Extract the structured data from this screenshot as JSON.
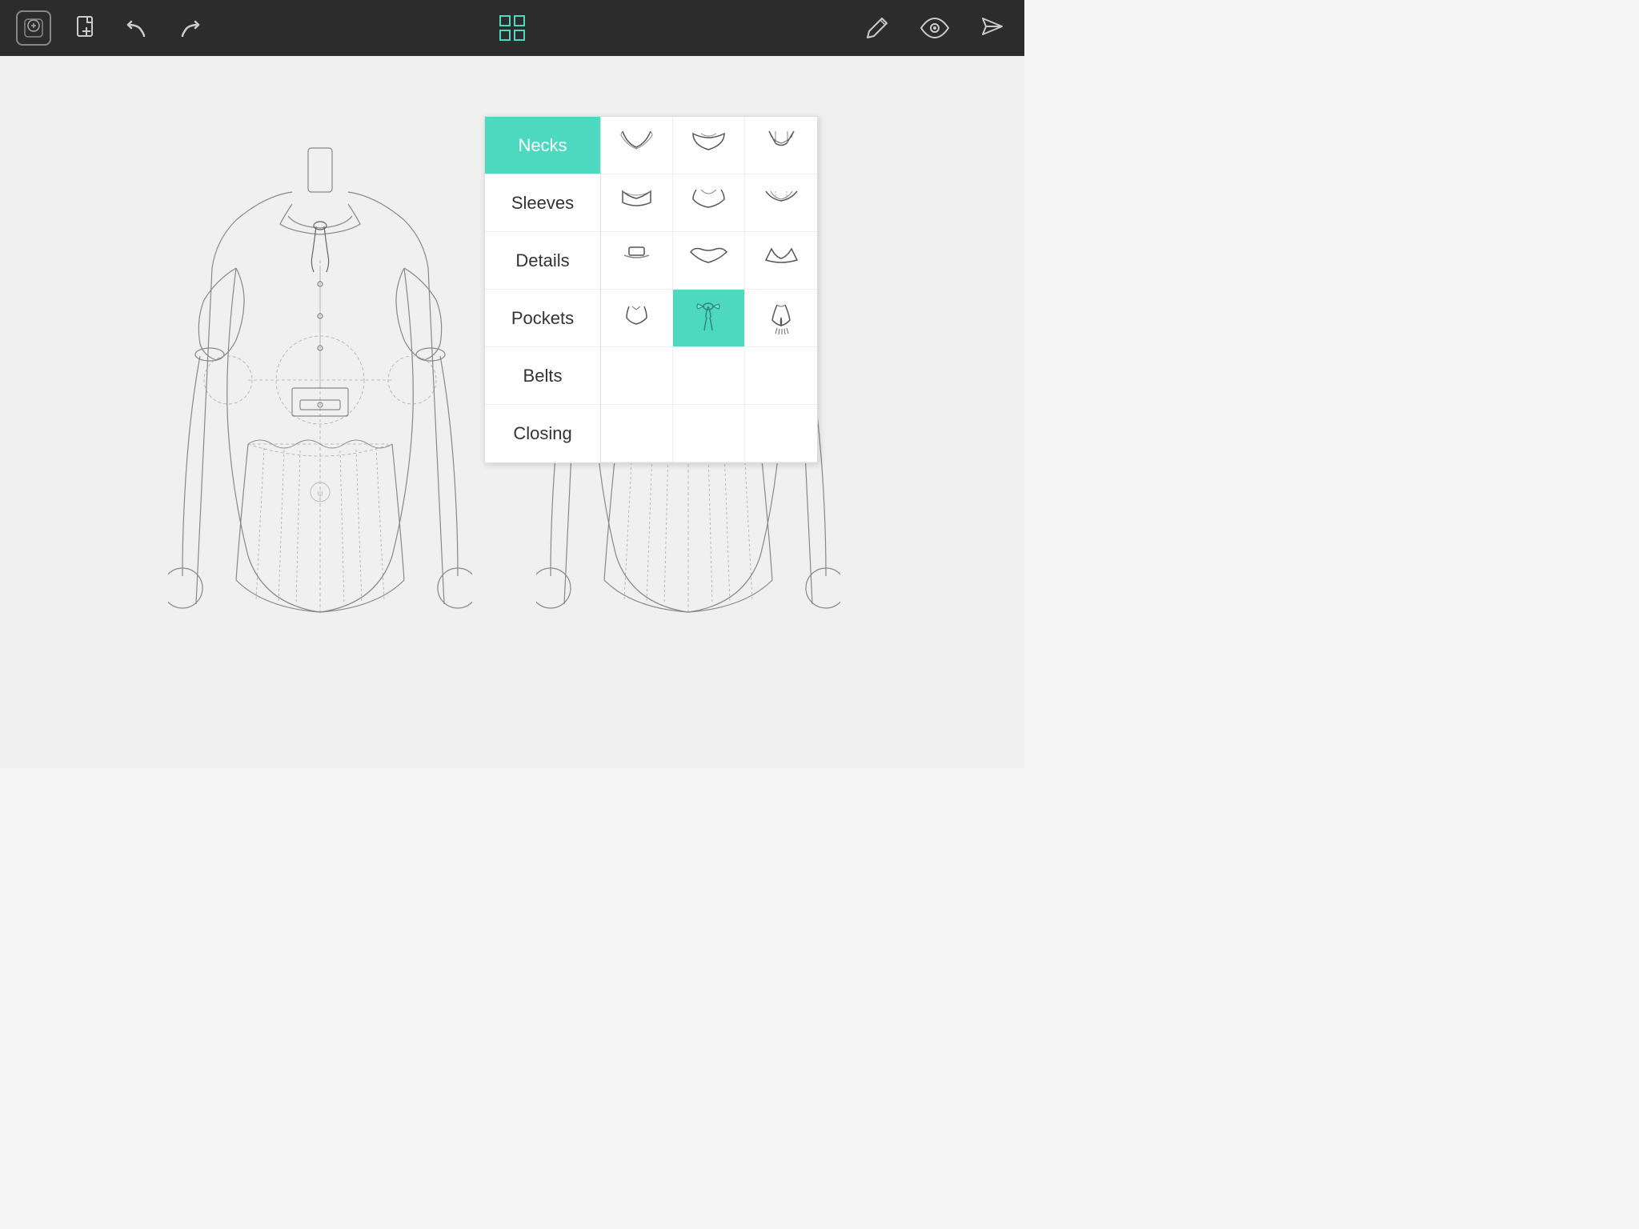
{
  "toolbar": {
    "logo_label": "ψ",
    "new_label": "+",
    "undo_label": "↩",
    "redo_label": "↪",
    "grid_label": "⊞",
    "pencil_label": "✏",
    "eye_label": "👁",
    "send_label": "➤"
  },
  "panel": {
    "categories": [
      {
        "id": "necks",
        "label": "Necks",
        "active": true
      },
      {
        "id": "sleeves",
        "label": "Sleeves",
        "active": false
      },
      {
        "id": "details",
        "label": "Details",
        "active": false
      },
      {
        "id": "pockets",
        "label": "Pockets",
        "active": false
      },
      {
        "id": "belts",
        "label": "Belts",
        "active": false
      },
      {
        "id": "closing",
        "label": "Closing",
        "active": false
      }
    ]
  },
  "colors": {
    "accent": "#4dd9c0",
    "toolbar_bg": "#2c2c2c",
    "text_dark": "#333333",
    "border": "#dddddd"
  }
}
